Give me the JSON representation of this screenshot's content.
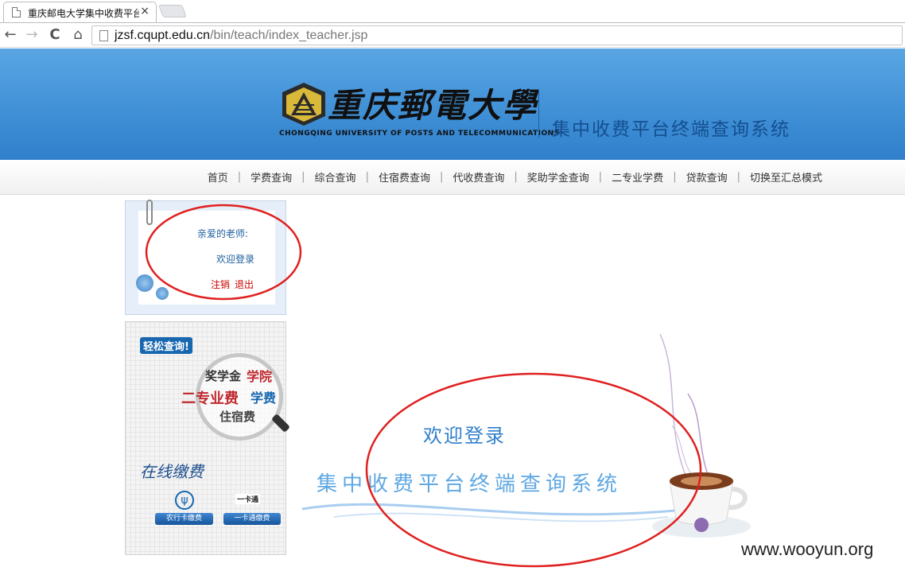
{
  "browser": {
    "tab_title": "重庆邮电大学集中收费平台",
    "tab_close": "×",
    "url_domain": "jzsf.cqupt.edu.cn",
    "url_path": "/bin/teach/index_teacher.jsp",
    "back_glyph": "←",
    "forward_glyph": "→",
    "reload_glyph": "C",
    "home_glyph": "⌂"
  },
  "header": {
    "university_name": "重庆郵電大學",
    "university_english": "CHONGQING UNIVERSITY OF POSTS AND TELECOMMUNICATIONS",
    "system_title": "集中收费平台终端查询系统"
  },
  "nav": {
    "items": [
      "首页",
      "学费查询",
      "综合查询",
      "住宿费查询",
      "代收费查询",
      "奖助学金查询",
      "二专业学费",
      "贷款查询",
      "切换至汇总模式"
    ],
    "separator": "|"
  },
  "welcome_card": {
    "greeting": "亲爱的老师:",
    "welcome": "欢迎登录",
    "logout": "注销",
    "exit": "退出"
  },
  "ad_card": {
    "badge": "轻松查询!",
    "word_scholarship": "奖学金",
    "word_college": "学院",
    "word_second_major": "二专业费",
    "word_tuition": "学费",
    "word_dorm": "住宿费",
    "online_pay": "在线缴费",
    "card_label": "一卡通",
    "btn_abc": "农行卡缴费",
    "btn_card": "一卡通缴费"
  },
  "main": {
    "welcome": "欢迎登录",
    "system_title": "集中收费平台终端查询系统"
  },
  "watermark": "www.wooyun.org",
  "colors": {
    "banner": "#3f8fd6",
    "welcome_blue": "#1c5e9e",
    "logout_red": "#cc0000",
    "annotation_red": "#e02020"
  }
}
